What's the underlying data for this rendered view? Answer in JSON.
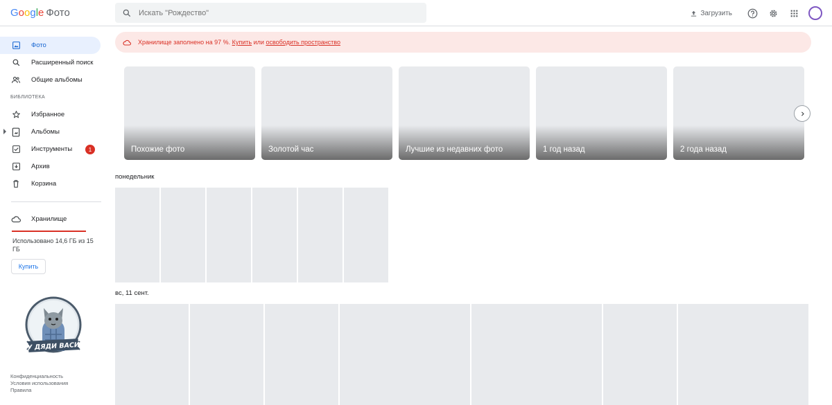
{
  "header": {
    "logo_letters": [
      {
        "ch": "G",
        "color": "#4285f4"
      },
      {
        "ch": "o",
        "color": "#ea4335"
      },
      {
        "ch": "o",
        "color": "#fbbc05"
      },
      {
        "ch": "g",
        "color": "#4285f4"
      },
      {
        "ch": "l",
        "color": "#34a853"
      },
      {
        "ch": "e",
        "color": "#ea4335"
      }
    ],
    "product": "Фото",
    "search_placeholder": "Искать \"Рождество\"",
    "upload_label": "Загрузить",
    "help_icon": "help-icon",
    "settings_icon": "gear-icon",
    "apps_icon": "apps-grid-icon"
  },
  "sidebar": {
    "items": [
      {
        "label": "Фото",
        "icon": "photo-icon",
        "active": true
      },
      {
        "label": "Расширенный поиск",
        "icon": "search-icon"
      },
      {
        "label": "Общие альбомы",
        "icon": "people-icon"
      }
    ],
    "library_heading": "БИБЛИОТЕКА",
    "library_items": [
      {
        "label": "Избранное",
        "icon": "star-icon"
      },
      {
        "label": "Альбомы",
        "icon": "album-icon"
      },
      {
        "label": "Инструменты",
        "icon": "tools-icon",
        "badge": "1"
      },
      {
        "label": "Архив",
        "icon": "archive-icon"
      },
      {
        "label": "Корзина",
        "icon": "trash-icon"
      }
    ],
    "storage": {
      "label": "Хранилище",
      "used_text": "Использовано 14,6 ГБ из 15 ГБ",
      "used_fraction": 0.973,
      "buy_label": "Купить"
    },
    "watermark_text": "У ДЯДИ ВАСИ",
    "footer": [
      "Конфиденциальность",
      "Условия использования",
      "Правила"
    ]
  },
  "banner": {
    "text": "Хранилище заполнено на 97 %.",
    "buy_link": "Купить",
    "or_text": "или",
    "free_link": "освободить пространство",
    "color": "#d93025",
    "background": "#fce8e6"
  },
  "memories": [
    "Похожие фото",
    "Золотой час",
    "Лучшие из недавних фото",
    "1 год назад",
    "2 года назад"
  ],
  "groups": [
    {
      "date": "понедельник",
      "photo_count": 6
    },
    {
      "date": "вс, 11 сент.",
      "photo_count": 9
    }
  ],
  "colors": {
    "accent": "#1a73e8",
    "active_nav_bg": "#e8f0fe",
    "placeholder": "#e8eaed",
    "avatar_ring": "#7e57c2"
  }
}
